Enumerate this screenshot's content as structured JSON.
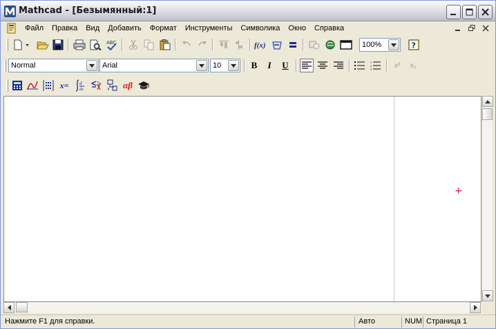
{
  "window": {
    "title": "Mathcad - [Безымянный:1]"
  },
  "menu": {
    "items": [
      "Файл",
      "Правка",
      "Вид",
      "Добавить",
      "Формат",
      "Инструменты",
      "Символика",
      "Окно",
      "Справка"
    ]
  },
  "standard_toolbar": {
    "zoom_value": "100%",
    "icons": [
      "new-document-icon",
      "open-folder-icon",
      "save-icon",
      "print-icon",
      "print-preview-icon",
      "spell-check-icon",
      "cut-icon",
      "copy-icon",
      "paste-icon",
      "undo-icon",
      "redo-icon",
      "align-top-icon",
      "align-left-icon",
      "insert-function-icon",
      "insert-unit-icon",
      "calculate-icon",
      "insert-component-icon",
      "resource-center-icon",
      "insert-region-icon",
      "help-icon"
    ]
  },
  "formatting_toolbar": {
    "style_value": "Normal",
    "font_value": "Arial",
    "size_value": "10",
    "bold_label": "B",
    "italic_label": "I",
    "underline_label": "U",
    "superscript_label": "x²",
    "subscript_label": "x₂"
  },
  "math_toolbar": {
    "icons": [
      "calculator-palette-icon",
      "graph-palette-icon",
      "matrix-palette-icon",
      "evaluation-palette-icon",
      "calculus-palette-icon",
      "boolean-palette-icon",
      "programming-palette-icon",
      "greek-palette-icon",
      "symbolic-palette-icon"
    ],
    "evaluation_label": "x=",
    "greek_label": "αβ"
  },
  "status": {
    "help_text": "Нажмите F1 для справки.",
    "mode": "Авто",
    "num": "NUM",
    "page": "Страница 1"
  },
  "colors": {
    "accent_red": "#e0102a",
    "math_blue": "#1b2a8a"
  }
}
